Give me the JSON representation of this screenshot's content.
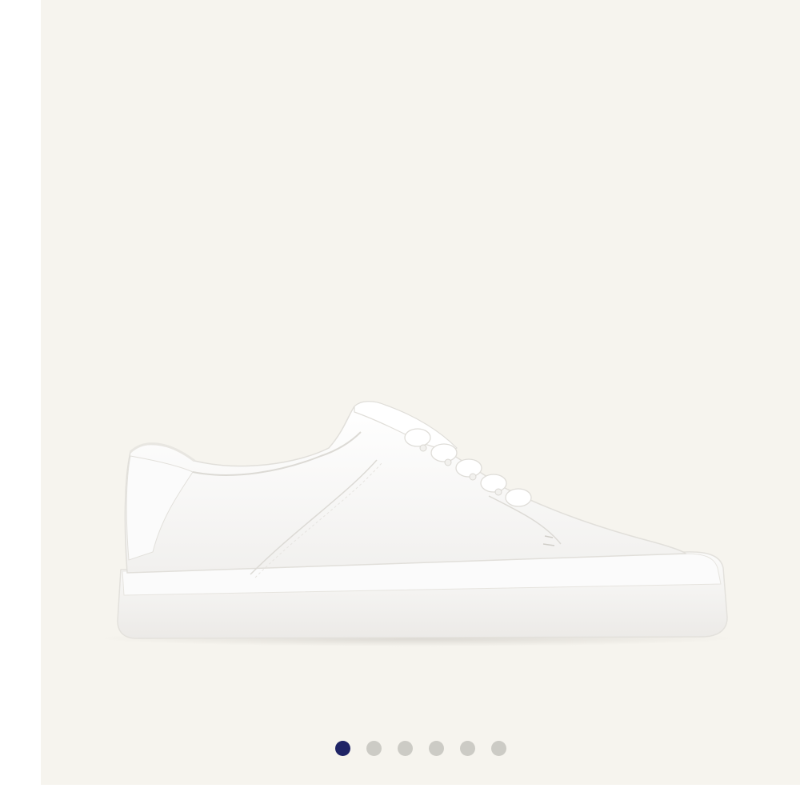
{
  "gallery": {
    "image_icon": "white-leather-sneaker",
    "background_color": "#f6f4ee",
    "active_dot_color": "#1f2466",
    "inactive_dot_color": "#cccbc5",
    "total_slides": 6,
    "active_slide": 1
  }
}
